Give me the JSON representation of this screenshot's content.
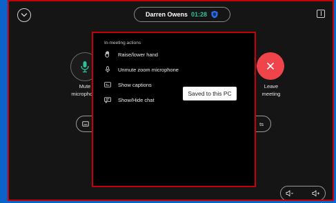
{
  "header": {
    "participant_name": "Darren Owens",
    "timer": "01:28"
  },
  "controls": {
    "mute_label": "Mute\nmicrophone",
    "leave_label": "Leave\nmeeting",
    "right_pill_text": "ts"
  },
  "actions_panel": {
    "title": "In-meeting actions",
    "items": [
      {
        "icon": "hand-icon",
        "label": "Raise/lower hand"
      },
      {
        "icon": "microphone-icon",
        "label": "Unmute zoom microphone"
      },
      {
        "icon": "captions-icon",
        "label": "Show captions"
      },
      {
        "icon": "chat-icon",
        "label": "Show/Hide chat"
      }
    ]
  },
  "tooltip": {
    "text": "Saved to this PC"
  },
  "colors": {
    "accent_green": "#2fc19c",
    "leave_red": "#f0444b",
    "focus_outline": "#c8000a",
    "shield_blue": "#2a6ff2"
  }
}
